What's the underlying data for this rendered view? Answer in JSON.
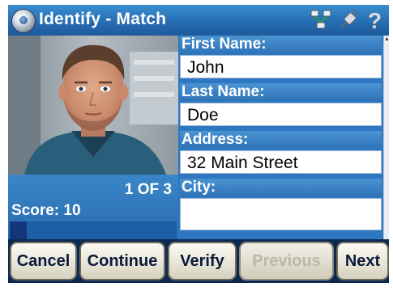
{
  "window": {
    "title": "Identify - Match",
    "icons": [
      "app-icon",
      "network-icon",
      "plug-icon",
      "help-icon"
    ]
  },
  "match": {
    "count_text": "1 OF 3",
    "score_label": "Score: 10",
    "score_fraction": 0.1
  },
  "fields": [
    {
      "label": "First Name:",
      "value": "John"
    },
    {
      "label": "Last Name:",
      "value": "Doe"
    },
    {
      "label": "Address:",
      "value": "32 Main Street"
    },
    {
      "label": "City:",
      "value": ""
    }
  ],
  "buttons": {
    "cancel": "Cancel",
    "continue": "Continue",
    "verify": "Verify",
    "previous": "Previous",
    "next": "Next"
  },
  "colors": {
    "title_bar": "#2a72b8",
    "panel_blue": "#2d78c0",
    "frame": "#0c2a50"
  }
}
